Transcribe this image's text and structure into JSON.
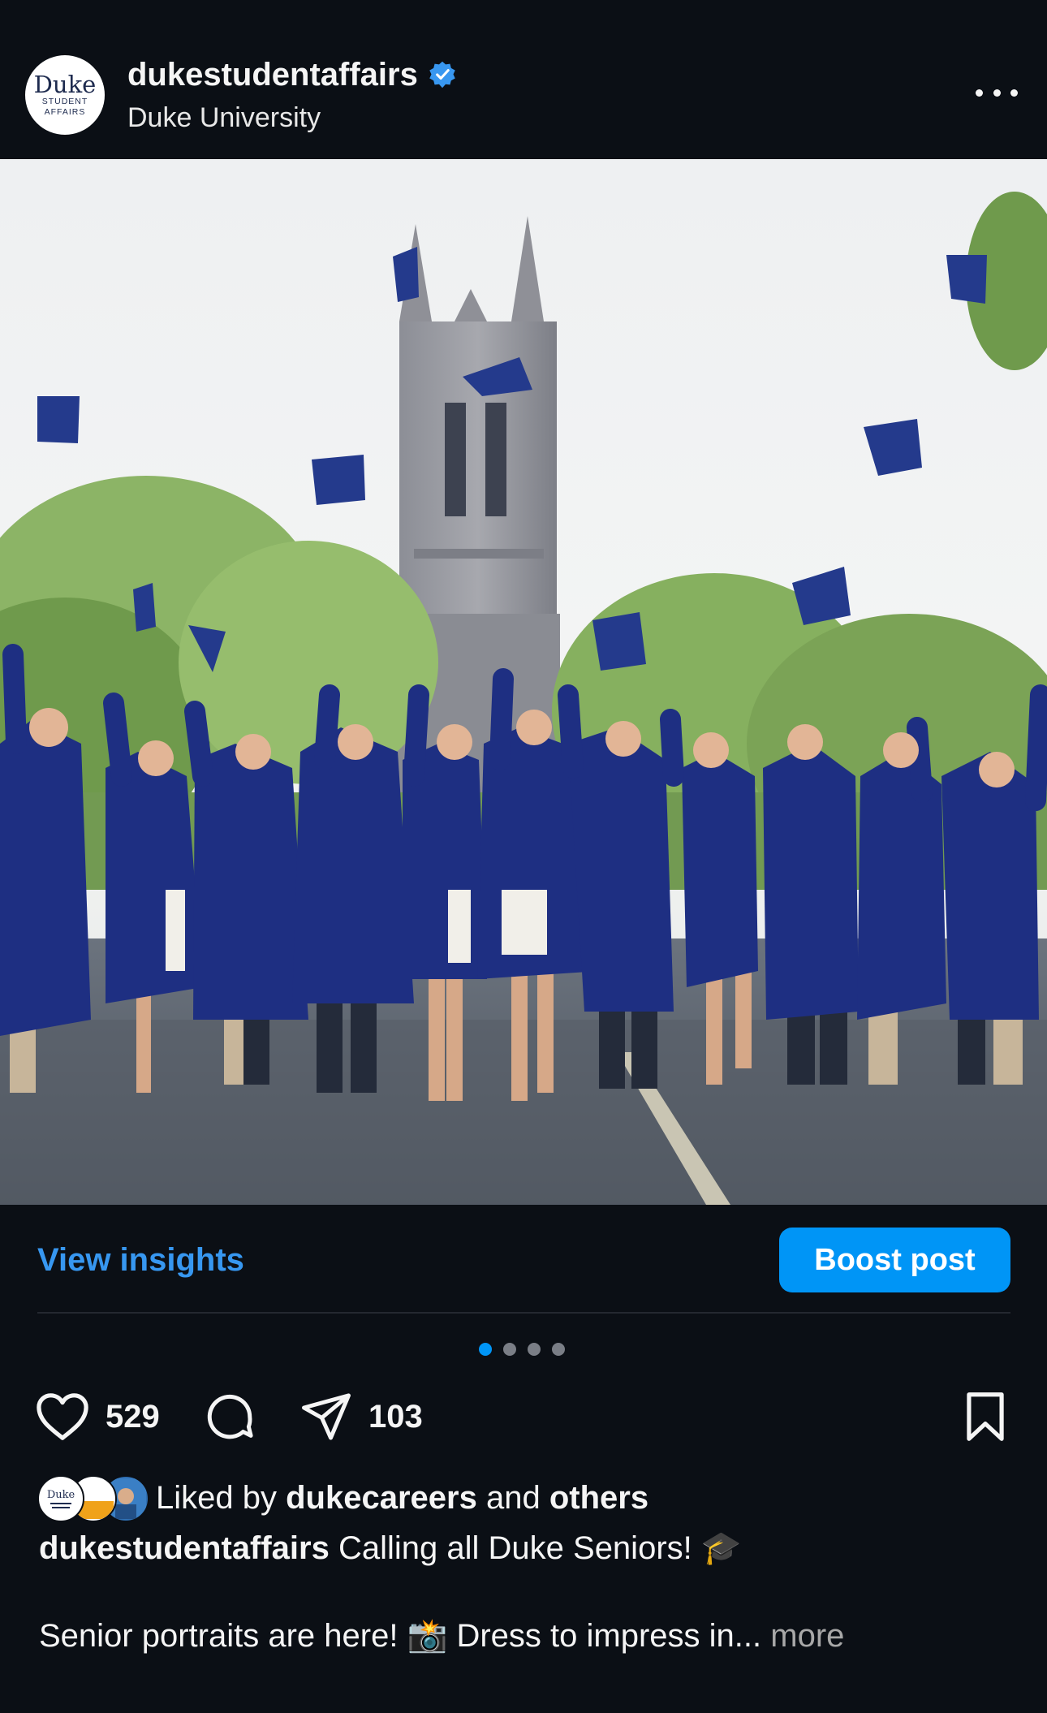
{
  "header": {
    "avatar_brand": "Duke",
    "avatar_sub": "STUDENT AFFAIRS",
    "username": "dukestudentaffairs",
    "subtitle": "Duke University",
    "verified_icon": "verified-badge-icon",
    "more_icon": "more-options-icon"
  },
  "post": {
    "image_alt": "Duke seniors in blue graduation gowns tossing caps in front of Duke Chapel"
  },
  "toolbar": {
    "insights_label": "View insights",
    "boost_label": "Boost post"
  },
  "carousel": {
    "total": 4,
    "active_index": 0
  },
  "actions": {
    "like_count": "529",
    "share_count": "103",
    "like_icon": "heart-icon",
    "comment_icon": "comment-icon",
    "share_icon": "send-icon",
    "save_icon": "bookmark-icon"
  },
  "likes": {
    "prefix": "Liked by",
    "user": "dukecareers",
    "middle": "and",
    "others": "others"
  },
  "caption": {
    "username": "dukestudentaffairs",
    "line1": "Calling all Duke Seniors! 🎓",
    "line2": "Senior portraits are here! 📸 Dress to impress in...",
    "more": "more"
  },
  "colors": {
    "background": "#0b0f15",
    "accent": "#0095f6",
    "link": "#3797f0",
    "gown": "#1c2d7a"
  }
}
